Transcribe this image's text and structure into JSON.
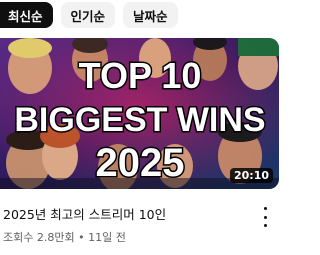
{
  "filters": {
    "chips": [
      {
        "label": "최신순",
        "active": true
      },
      {
        "label": "인기순",
        "active": false
      },
      {
        "label": "날짜순",
        "active": false
      }
    ]
  },
  "video": {
    "thumbnail_text": {
      "line1": "TOP 10",
      "line2": "BIGGEST WINS",
      "line3": "2025"
    },
    "duration": "20:10",
    "title": "2025년 최고의 스트리머 10인",
    "views": "조회수 2.8만회",
    "separator": "•",
    "age": "11일 전",
    "more_icon": "vertical-ellipsis-icon"
  }
}
